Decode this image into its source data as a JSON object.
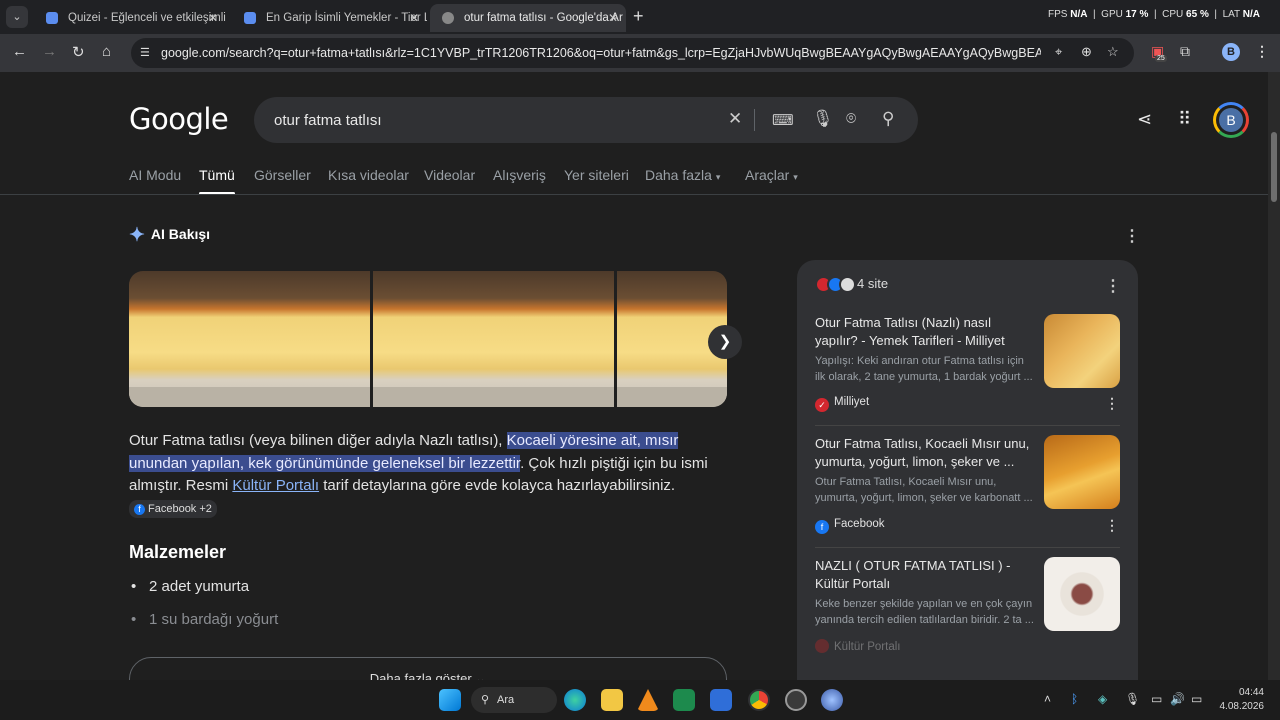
{
  "browser": {
    "tabs": [
      {
        "title": "Quizei - Eğlenceli ve etkileşimli",
        "active": false
      },
      {
        "title": "En Garip İsimli Yemekler - Tier L",
        "active": false
      },
      {
        "title": "otur fatma tatlısı - Google'da Ar",
        "active": true
      }
    ],
    "perf": {
      "fps_label": "FPS",
      "fps": "N/A",
      "gpu_label": "GPU",
      "gpu": "17 %",
      "cpu_label": "CPU",
      "cpu": "65 %",
      "lat_label": "LAT",
      "lat": "N/A"
    },
    "url": "google.com/search?q=otur+fatma+tatlısı&rlz=1C1YVBP_trTR1206TR1206&oq=otur+fatm&gs_lcrp=EgZjaHJvbWUqBwgBEAAYgAQyBwgAEAAYgAQyBwgBEAAYgAQyBwgBwg...",
    "extension_badge": "25",
    "profile_letter": "B"
  },
  "google": {
    "logo": "Google",
    "query": "otur fatma tatlısı",
    "profile_letter": "B",
    "nav_tabs": [
      "AI Modu",
      "Tümü",
      "Görseller",
      "Kısa videolar",
      "Videolar",
      "Alışveriş",
      "Yer siteleri",
      "Daha fazla",
      "Araçlar"
    ],
    "active_tab": "Tümü"
  },
  "ai_overview": {
    "title": "AI Bakışı",
    "text_1": "Otur Fatma tatlısı (veya bilinen diğer adıyla Nazlı tatlısı), ",
    "highlight": "Kocaeli yöresine ait, mısır unundan yapılan, kek görünümünde geleneksel bir lezzettir",
    "text_2": ". Çok hızlı piştiği için bu ismi almıştır. Resmi ",
    "link": "Kültür Portalı",
    "text_3": " tarif detaylarına göre evde kolayca hazırlayabilirsiniz.",
    "chip": "Facebook +2",
    "section_title": "Malzemeler",
    "ingredients": [
      "2 adet yumurta",
      "1 su bardağı yoğurt"
    ],
    "more_button": "Daha fazla göster"
  },
  "sources": {
    "count_label": "4 site",
    "items": [
      {
        "title": "Otur Fatma Tatlısı (Nazlı) nasıl yapılır? - Yemek Tarifleri - Milliyet",
        "desc": "Yapılışı: Keki andıran otur Fatma tatlısı için ilk olarak, 2 tane yumurta, 1 bardak yoğurt ...",
        "site": "Milliyet",
        "color": "#d3272f"
      },
      {
        "title": "Otur Fatma Tatlısı, Kocaeli Mısır unu, yumurta, yoğurt, limon, şeker ve ...",
        "desc": "Otur Fatma Tatlısı, Kocaeli Mısır unu, yumurta, yoğurt, limon, şeker ve karbonatt ...",
        "site": "Facebook",
        "color": "#1877f2"
      },
      {
        "title": "NAZLI ( OTUR FATMA TATLISI ) - Kültür Portalı",
        "desc": "Keke benzer şekilde yapılan ve en çok çayın yanında tercih edilen tatlılardan biridir. 2 ta ...",
        "site": "Kültür Portalı",
        "color": "#c62828"
      }
    ]
  },
  "taskbar": {
    "search_label": "Ara",
    "time": "04:44",
    "date": "4.08.2026"
  }
}
